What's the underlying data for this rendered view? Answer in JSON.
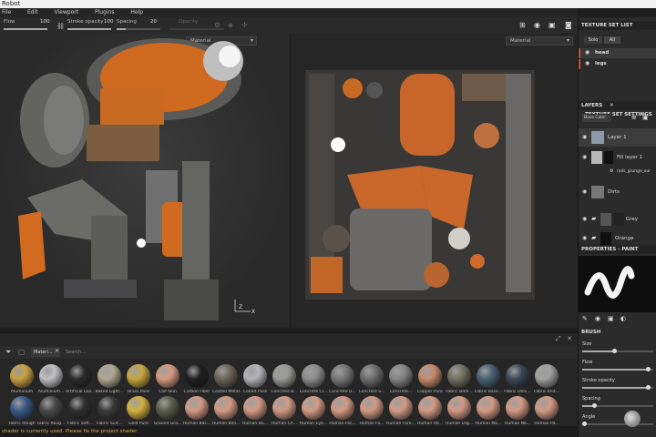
{
  "app": {
    "title": "Robot"
  },
  "menu": [
    "File",
    "Edit",
    "Viewport",
    "Plugins",
    "Help"
  ],
  "toolbar": {
    "flow_label": "Flow",
    "flow_value": "100",
    "flow_fill": 1.0,
    "stroke_opacity_label": "Stroke opacity",
    "stroke_opacity_value": "100",
    "stroke_opacity_fill": 1.0,
    "spacing_label": "Spacing",
    "spacing_value": "20",
    "spacing_fill": 0.2,
    "dimmed_label": "Opacity"
  },
  "viewport3d": {
    "material_select": "Material"
  },
  "viewport2d": {
    "material_select": "Material"
  },
  "texture_set_list": {
    "title": "TEXTURE SET LIST",
    "tabs": [
      "Solo",
      "All"
    ],
    "items": [
      "head",
      "legs"
    ]
  },
  "layers": {
    "tab_layers": "LAYERS",
    "tab_settings": "TEXTURE SET SETTINGS",
    "blend_mode": "Base Color",
    "items": [
      {
        "name": "Layer 1"
      },
      {
        "name": "Fill layer 1"
      },
      {
        "name": "rails_grunge_sur"
      },
      {
        "name": "Dirts"
      },
      {
        "name": "Grey"
      },
      {
        "name": "Orange"
      }
    ]
  },
  "properties": {
    "title": "PROPERTIES - PAINT",
    "brush_header": "BRUSH",
    "fields": [
      {
        "label": "Size",
        "fill": 0.45
      },
      {
        "label": "Flow",
        "fill": 0.95
      },
      {
        "label": "Stroke opacity",
        "fill": 0.95
      },
      {
        "label": "Spacing",
        "fill": 0.15
      },
      {
        "label": "Angle",
        "fill": 0.0
      }
    ]
  },
  "shelf": {
    "tab_label": "Materi...",
    "search_placeholder": "Search...",
    "row1": [
      {
        "name": "Aluminium",
        "color": "#c9a040"
      },
      {
        "name": "Aluminium...",
        "color": "#c0c0c4"
      },
      {
        "name": "Artificial Lea...",
        "color": "#2a2a2a"
      },
      {
        "name": "Baked Light...",
        "color": "#b0a890"
      },
      {
        "name": "Brass Pure",
        "color": "#c8a63e"
      },
      {
        "name": "Calf Skin",
        "color": "#d59a80"
      },
      {
        "name": "Carbon Fiber",
        "color": "#202020"
      },
      {
        "name": "Coated Metal",
        "color": "#6c665a"
      },
      {
        "name": "Cobalt Pure",
        "color": "#b4b4b8"
      },
      {
        "name": "Concrete B...",
        "color": "#9a9a98"
      },
      {
        "name": "Concrete Cl...",
        "color": "#8d8d8d"
      },
      {
        "name": "Concrete D...",
        "color": "#777777"
      },
      {
        "name": "Concrete S...",
        "color": "#6d6d6d"
      },
      {
        "name": "Concrete...",
        "color": "#858585"
      },
      {
        "name": "Copper Pure",
        "color": "#c88a6a"
      },
      {
        "name": "Fabric Bam...",
        "color": "#727060"
      },
      {
        "name": "Fabric Base...",
        "color": "#4a6074"
      },
      {
        "name": "Fabric Deni...",
        "color": "#3c4858"
      },
      {
        "name": "Fabric Knit...",
        "color": "#a0a0a0"
      }
    ],
    "row2": [
      {
        "name": "Fabric Rough",
        "color": "#3a5a88"
      },
      {
        "name": "Fabric Roug...",
        "color": "#4a4a4a"
      },
      {
        "name": "Fabric Soft...",
        "color": "#303030"
      },
      {
        "name": "Fabric Suit...",
        "color": "#3a3a3a"
      },
      {
        "name": "Gold Pure",
        "color": "#d4b040"
      },
      {
        "name": "Ground Gra...",
        "color": "#5a5e48"
      },
      {
        "name": "Human Bac...",
        "color": "#d39a84"
      },
      {
        "name": "Human Bell...",
        "color": "#d39a84"
      },
      {
        "name": "Human Bu...",
        "color": "#d39a84"
      },
      {
        "name": "Human Ch...",
        "color": "#d39a84"
      },
      {
        "name": "Human Eye...",
        "color": "#d39a84"
      },
      {
        "name": "Human Fac...",
        "color": "#d39a84"
      },
      {
        "name": "Human Fo...",
        "color": "#d39a84"
      },
      {
        "name": "Human Fore...",
        "color": "#d39a84"
      },
      {
        "name": "Human He...",
        "color": "#d39a84"
      },
      {
        "name": "Human Leg...",
        "color": "#d39a84"
      },
      {
        "name": "Human Mo...",
        "color": "#d39a84"
      },
      {
        "name": "Human Ne...",
        "color": "#d39a84"
      },
      {
        "name": "Human Pa...",
        "color": "#d39a84"
      }
    ]
  },
  "status": {
    "message": "shader is currently used. Please fix the project shader."
  }
}
